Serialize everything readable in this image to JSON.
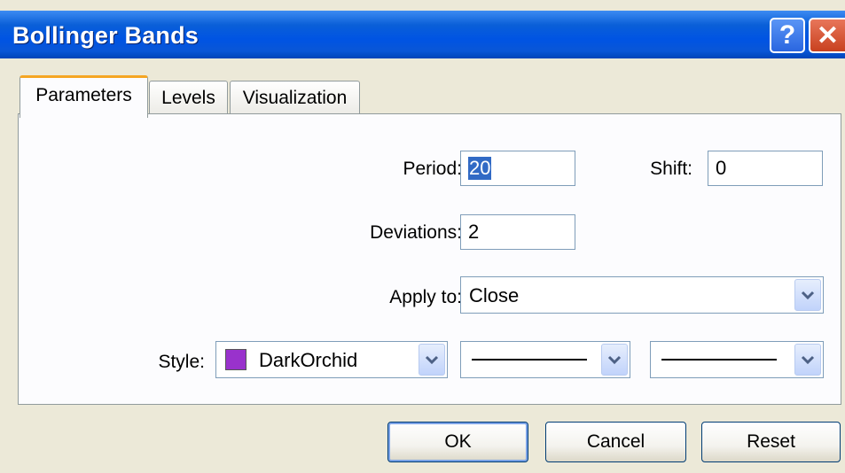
{
  "window": {
    "title": "Bollinger Bands",
    "help_button": "?",
    "close_button": "✕"
  },
  "tabs": [
    {
      "label": "Parameters",
      "active": true
    },
    {
      "label": "Levels",
      "active": false
    },
    {
      "label": "Visualization",
      "active": false
    }
  ],
  "parameters": {
    "period_label": "Period:",
    "period_value": "20",
    "shift_label": "Shift:",
    "shift_value": "0",
    "deviations_label": "Deviations:",
    "deviations_value": "2",
    "apply_to_label": "Apply to:",
    "apply_to_value": "Close",
    "style_label": "Style:",
    "style_color_name": "DarkOrchid",
    "style_color_hex": "#9932cc"
  },
  "buttons": {
    "ok": "OK",
    "cancel": "Cancel",
    "reset": "Reset"
  }
}
